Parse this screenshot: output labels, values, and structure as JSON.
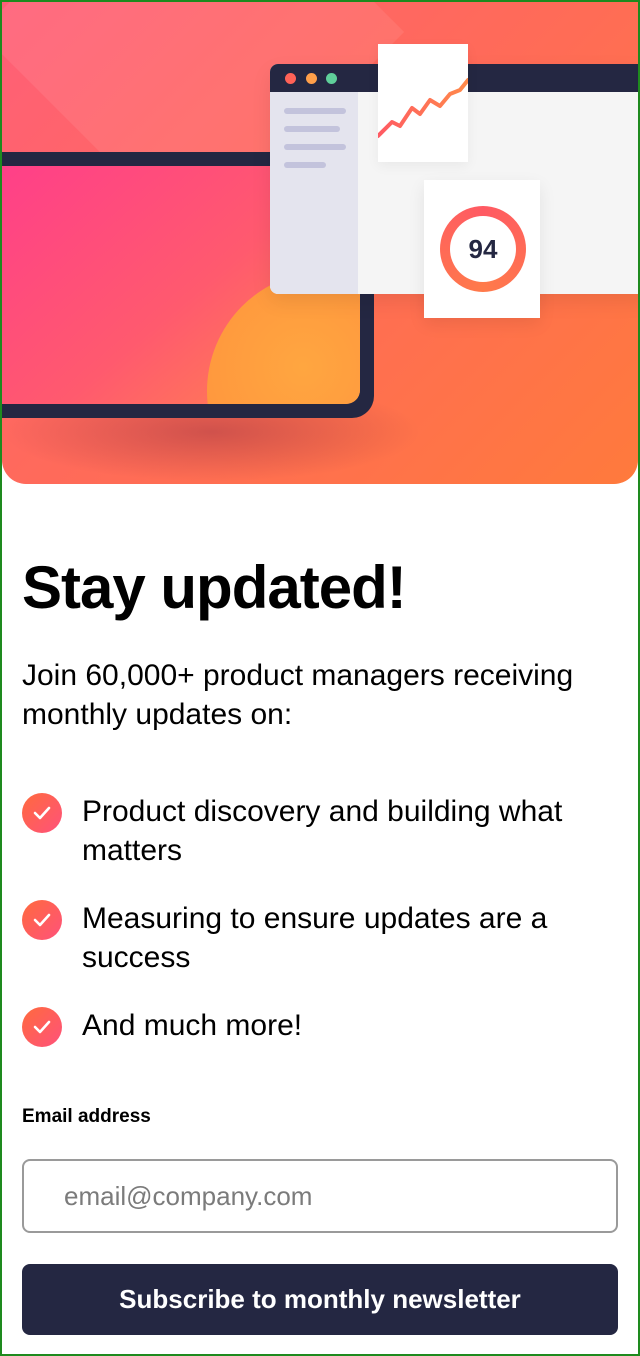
{
  "hero": {
    "score": "94",
    "colors": {
      "gradient_start": "#ff5f78",
      "gradient_end": "#ff7a3c",
      "dark": "#242742"
    }
  },
  "signup": {
    "title": "Stay updated!",
    "intro": "Join 60,000+ product managers receiving monthly updates on:",
    "features": [
      "Product discovery and building what matters",
      "Measuring to ensure updates are a success",
      "And much more!"
    ],
    "email_label": "Email address",
    "email_placeholder": "email@company.com",
    "email_value": "",
    "button_label": "Subscribe to monthly newsletter",
    "check_icon": "check-icon"
  }
}
